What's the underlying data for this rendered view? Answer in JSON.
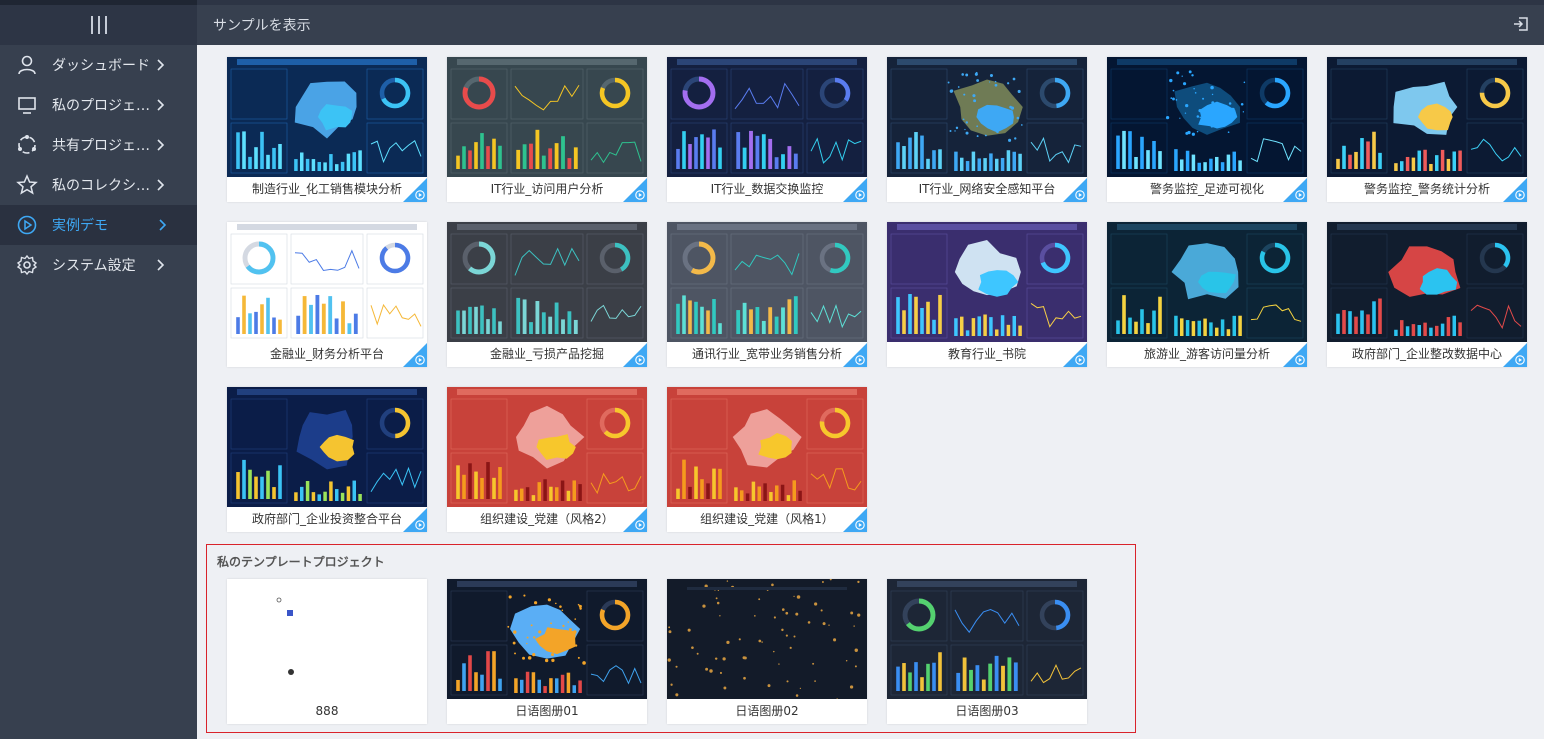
{
  "header": {
    "title": "サンプルを表示",
    "logout_icon": "logout-icon"
  },
  "sidebar": {
    "items": [
      {
        "label": "ダッシュボード",
        "icon": "user-icon",
        "active": false
      },
      {
        "label": "私のプロジェクト",
        "icon": "monitor-icon",
        "active": false
      },
      {
        "label": "共有プロジェクト",
        "icon": "share-circle-icon",
        "active": false
      },
      {
        "label": "私のコレクション",
        "icon": "star-icon",
        "active": false
      },
      {
        "label": "実例デモ",
        "icon": "play-circle-icon",
        "active": true
      },
      {
        "label": "システム設定",
        "icon": "gear-icon",
        "active": false
      }
    ]
  },
  "demos": [
    {
      "label": "制造行业_化工销售模块分析",
      "theme": "dark-blue"
    },
    {
      "label": "IT行业_访问用户分析",
      "theme": "teal-grey"
    },
    {
      "label": "IT行业_数据交换监控",
      "theme": "navy"
    },
    {
      "label": "IT行业_网络安全感知平台",
      "theme": "night-map"
    },
    {
      "label": "警务监控_足迹可视化",
      "theme": "deep-blue"
    },
    {
      "label": "警务监控_警务统计分析",
      "theme": "dark-navy"
    },
    {
      "label": "金融业_财务分析平台",
      "theme": "light"
    },
    {
      "label": "金融业_亏损产品挖掘",
      "theme": "charcoal"
    },
    {
      "label": "通讯行业_宽带业务销售分析",
      "theme": "slate"
    },
    {
      "label": "教育行业_书院",
      "theme": "purple"
    },
    {
      "label": "旅游业_游客访问量分析",
      "theme": "dark-teal"
    },
    {
      "label": "政府部门_企业整改数据中心",
      "theme": "dark-red"
    },
    {
      "label": "政府部门_企业投资整合平台",
      "theme": "navy-map"
    },
    {
      "label": "组织建设_党建（风格2）",
      "theme": "red"
    },
    {
      "label": "组织建设_党建（风格1）",
      "theme": "red"
    }
  ],
  "templates": {
    "title": "私のテンプレートプロジェクト",
    "items": [
      {
        "label": "888",
        "theme": "white"
      },
      {
        "label": "日语图册01",
        "theme": "night-city"
      },
      {
        "label": "日语图册02",
        "theme": "night-blur"
      },
      {
        "label": "日语图册03",
        "theme": "dark-dashboard"
      }
    ]
  },
  "colors": {
    "accent": "#3ea8f4",
    "sidebar": "#37404f",
    "highlight_border": "#d9232b"
  }
}
